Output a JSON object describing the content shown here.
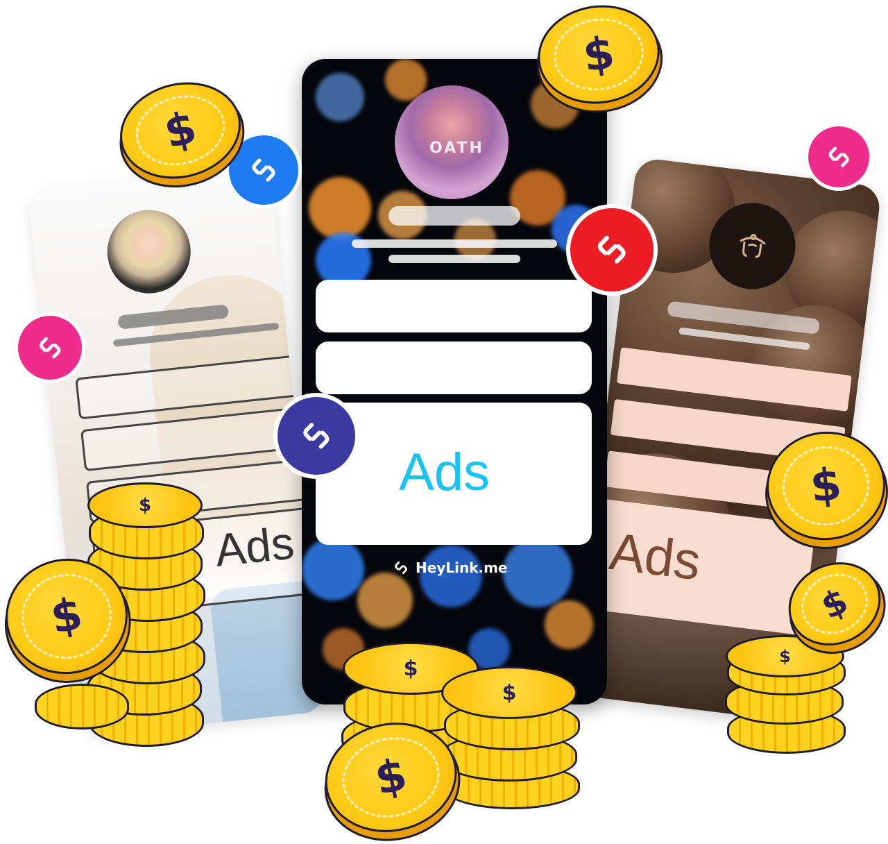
{
  "phones": {
    "left": {
      "ads_label": "Ads"
    },
    "center": {
      "ads_label": "Ads",
      "brand_name": "HeyLink.me",
      "avatar_shirt_text": "OATH"
    },
    "right": {
      "ads_label": "Ads"
    }
  },
  "coin_symbol": "$",
  "colors": {
    "badge_blue": "#1e7cf2",
    "badge_pink": "#ef2b8b",
    "badge_red": "#ee1c24",
    "badge_indigo": "#3a3aa0",
    "ads_cyan": "#19c3ef",
    "ads_brown": "#7a4a33",
    "coin_gold": "#ffcb17"
  },
  "icons": [
    "heylink-icon",
    "dollar-icon"
  ]
}
